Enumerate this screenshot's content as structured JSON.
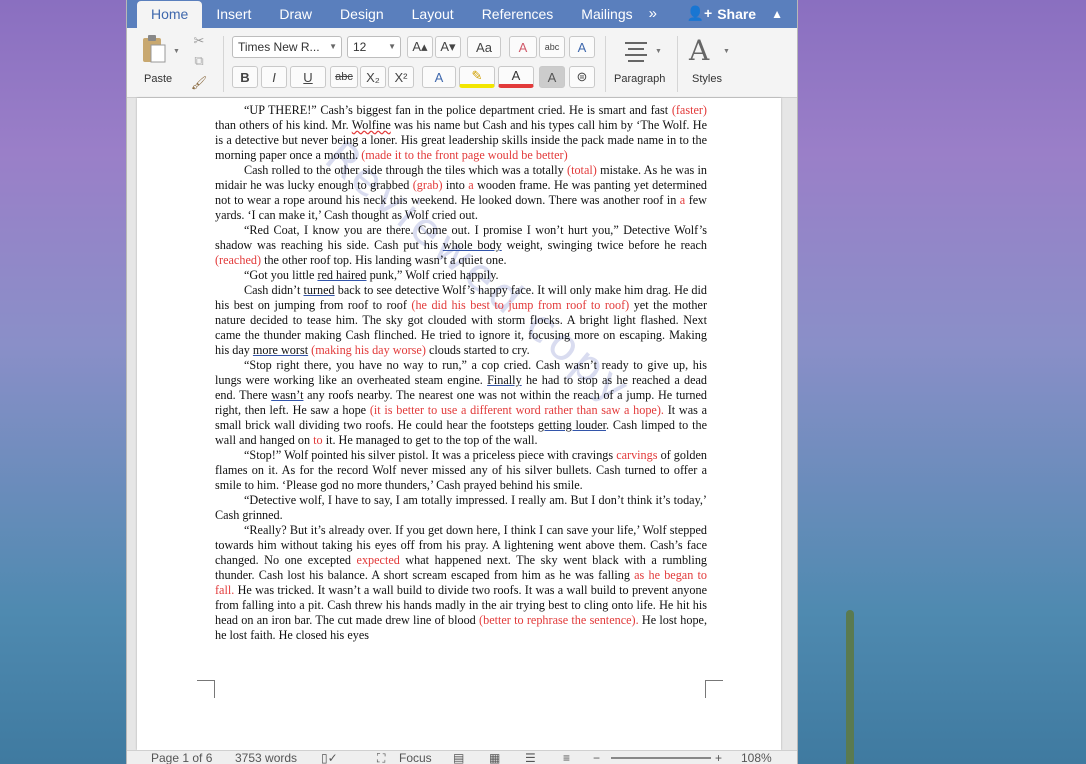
{
  "tabs": [
    "Home",
    "Insert",
    "Draw",
    "Design",
    "Layout",
    "References",
    "Mailings"
  ],
  "tab_more_icon": "double-chevron-right",
  "share": {
    "label": "Share"
  },
  "ribbon": {
    "paste_label": "Paste",
    "font_name": "Times New R...",
    "font_size": "12",
    "paragraph_label": "Paragraph",
    "styles_label": "Styles",
    "format_buttons": [
      "B",
      "I",
      "U"
    ],
    "strikethrough": "abc",
    "subscript": "X₂",
    "superscript": "X²",
    "grow_font": "A▴",
    "shrink_font": "A▾",
    "change_case": "Aa",
    "clear_format": "A",
    "text_effects": "A",
    "highlight": "✎",
    "font_color": "A",
    "shading": "A",
    "phonetic": "abc"
  },
  "document": {
    "paragraphs": [
      [
        [
          "“UP THERE!” Cash’s biggest fan in the police department cried. He is smart and fast ",
          ""
        ],
        [
          "(faster)",
          "red"
        ],
        [
          " than others of his kind. Mr. ",
          ""
        ],
        [
          "Wolfine",
          "ulred"
        ],
        [
          " was his name but Cash and his types call him by ‘The Wolf. He is a detective but never being a loner. His great leadership skills inside the pack made name in to the morning paper once a month. ",
          ""
        ],
        [
          "(made it to the front page would be better)",
          "red"
        ]
      ],
      [
        [
          "Cash rolled to the other side through the tiles which was a totally ",
          ""
        ],
        [
          "(total)",
          "red"
        ],
        [
          " mistake. As he was in midair he was lucky enough to grabbed ",
          ""
        ],
        [
          "(grab)",
          "red"
        ],
        [
          " into ",
          ""
        ],
        [
          "a",
          "red"
        ],
        [
          " wooden frame. He was panting yet determined not to wear a rope around his neck this weekend. He looked down. There was another roof in ",
          ""
        ],
        [
          "a",
          "red"
        ],
        [
          " few yards. ‘I can make it,’ Cash thought as Wolf cried out.",
          ""
        ]
      ],
      [
        [
          "“Red Coat, I know you are there. Come out. I promise I won’t hurt you,” Detective Wolf’s shadow was reaching his side. Cash put his ",
          ""
        ],
        [
          "whole body",
          "ul"
        ],
        [
          " weight, swinging twice before he reach ",
          ""
        ],
        [
          "(reached)",
          "red"
        ],
        [
          " the other roof top. His landing wasn’t a quiet one.",
          ""
        ]
      ],
      [
        [
          "“Got you little ",
          ""
        ],
        [
          "red haired",
          "ul"
        ],
        [
          " punk,” Wolf cried happily.",
          ""
        ]
      ],
      [
        [
          "Cash didn’t ",
          ""
        ],
        [
          "turned",
          "ul"
        ],
        [
          " back to see detective Wolf’s happy face. It will only make him drag. He did his best on jumping from roof to roof ",
          ""
        ],
        [
          "(he did his best to jump from roof to roof)",
          "red"
        ],
        [
          " yet the mother nature decided to tease him. The sky got clouded with storm flocks. A bright light flashed. Next came the thunder making Cash flinched. He tried to ignore it, focusing more on escaping. Making his day ",
          ""
        ],
        [
          "more worst",
          "ul"
        ],
        [
          " ",
          ""
        ],
        [
          "(making his day worse)",
          "red"
        ],
        [
          " clouds started to cry.",
          ""
        ]
      ],
      [
        [
          "“Stop right there, you have no way to run,” a cop cried. Cash wasn’t ready to give up, his lungs were working like an overheated steam engine. ",
          ""
        ],
        [
          "Finally",
          "ul"
        ],
        [
          " he had to stop as he reached a dead end. There ",
          ""
        ],
        [
          "wasn’t",
          "ul"
        ],
        [
          " any roofs nearby. The nearest one was not within the reach of a jump. He turned right, then left. He saw a hope ",
          ""
        ],
        [
          "(it is better to use a different word rather than saw a hope).",
          "red"
        ],
        [
          " It was a small brick wall dividing two roofs. He could hear the footsteps ",
          ""
        ],
        [
          "getting louder",
          "ul"
        ],
        [
          ". Cash limped to the wall and hanged on ",
          ""
        ],
        [
          "to",
          "red"
        ],
        [
          " it. He managed to get to the top of the wall.",
          ""
        ]
      ],
      [
        [
          "“Stop!” Wolf pointed his silver pistol. It was a priceless piece with cravings ",
          ""
        ],
        [
          "carvings",
          "red"
        ],
        [
          " of golden flames on it. As for the record Wolf never missed any of his silver bullets. Cash turned to offer a smile to him. ‘Please god no more thunders,’ Cash prayed behind his smile.",
          ""
        ]
      ],
      [
        [
          "“Detective wolf, I have to say, I am totally impressed. I really am. But I don’t think it’s today,’ Cash grinned.",
          ""
        ]
      ],
      [
        [
          "“Really? But it’s already over. If you get down here, I think I can save your life,’ Wolf stepped towards him without taking his eyes off from his pray. A lightening went above them. Cash’s face changed. No one excepted ",
          ""
        ],
        [
          "expected",
          "red"
        ],
        [
          " what happened next. The sky went black with a rumbling thunder. Cash lost his balance. A short scream escaped from him as he was falling ",
          ""
        ],
        [
          "as he began to fall.",
          "red"
        ],
        [
          " He was tricked. It wasn’t a wall build to divide two roofs. It was a wall build to prevent anyone from falling into a pit. Cash threw his hands madly in the air trying best to cling onto life. He hit his head on an iron bar. The cut made drew line of blood ",
          ""
        ],
        [
          "(better to rephrase the sentence).",
          "red"
        ],
        [
          " He lost hope, he lost faith. He closed his eyes",
          ""
        ]
      ]
    ]
  },
  "status": {
    "page": "Page 1 of 6",
    "words": "3753 words",
    "focus": "Focus",
    "zoom": "108%"
  },
  "colors": {
    "ribbon_blue": "#5a7fbd",
    "suggestion_red": "#e23a3a"
  }
}
